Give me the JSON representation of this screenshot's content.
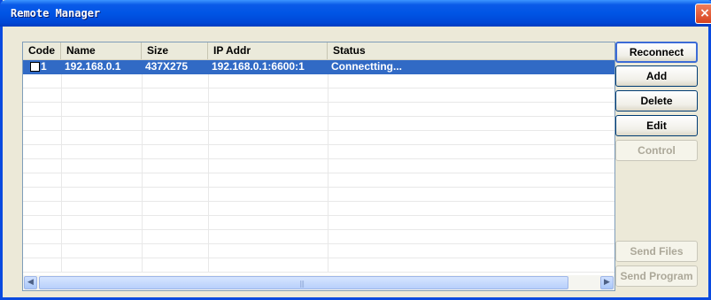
{
  "window": {
    "title": "Remote Manager",
    "close_glyph": "×"
  },
  "listview": {
    "columns": [
      "Code",
      "Name",
      "Size",
      "IP Addr",
      "Status"
    ],
    "rows": [
      {
        "code": "1",
        "name": "192.168.0.1",
        "size": "437X275",
        "ip": "192.168.0.1:6600:1",
        "status": "Connectting...",
        "checked": false,
        "selected": true
      }
    ]
  },
  "scrollbar": {
    "left_glyph": "◀",
    "right_glyph": "▶",
    "grip_glyph": "|||"
  },
  "buttons": {
    "reconnect": "Reconnect",
    "add": "Add",
    "delete": "Delete",
    "edit": "Edit",
    "control": "Control",
    "send_files": "Send Files",
    "send_program": "Send Program"
  },
  "colors": {
    "titlebar": "#0055e5",
    "selection": "#316ac5",
    "dialog_bg": "#ece9d8"
  }
}
